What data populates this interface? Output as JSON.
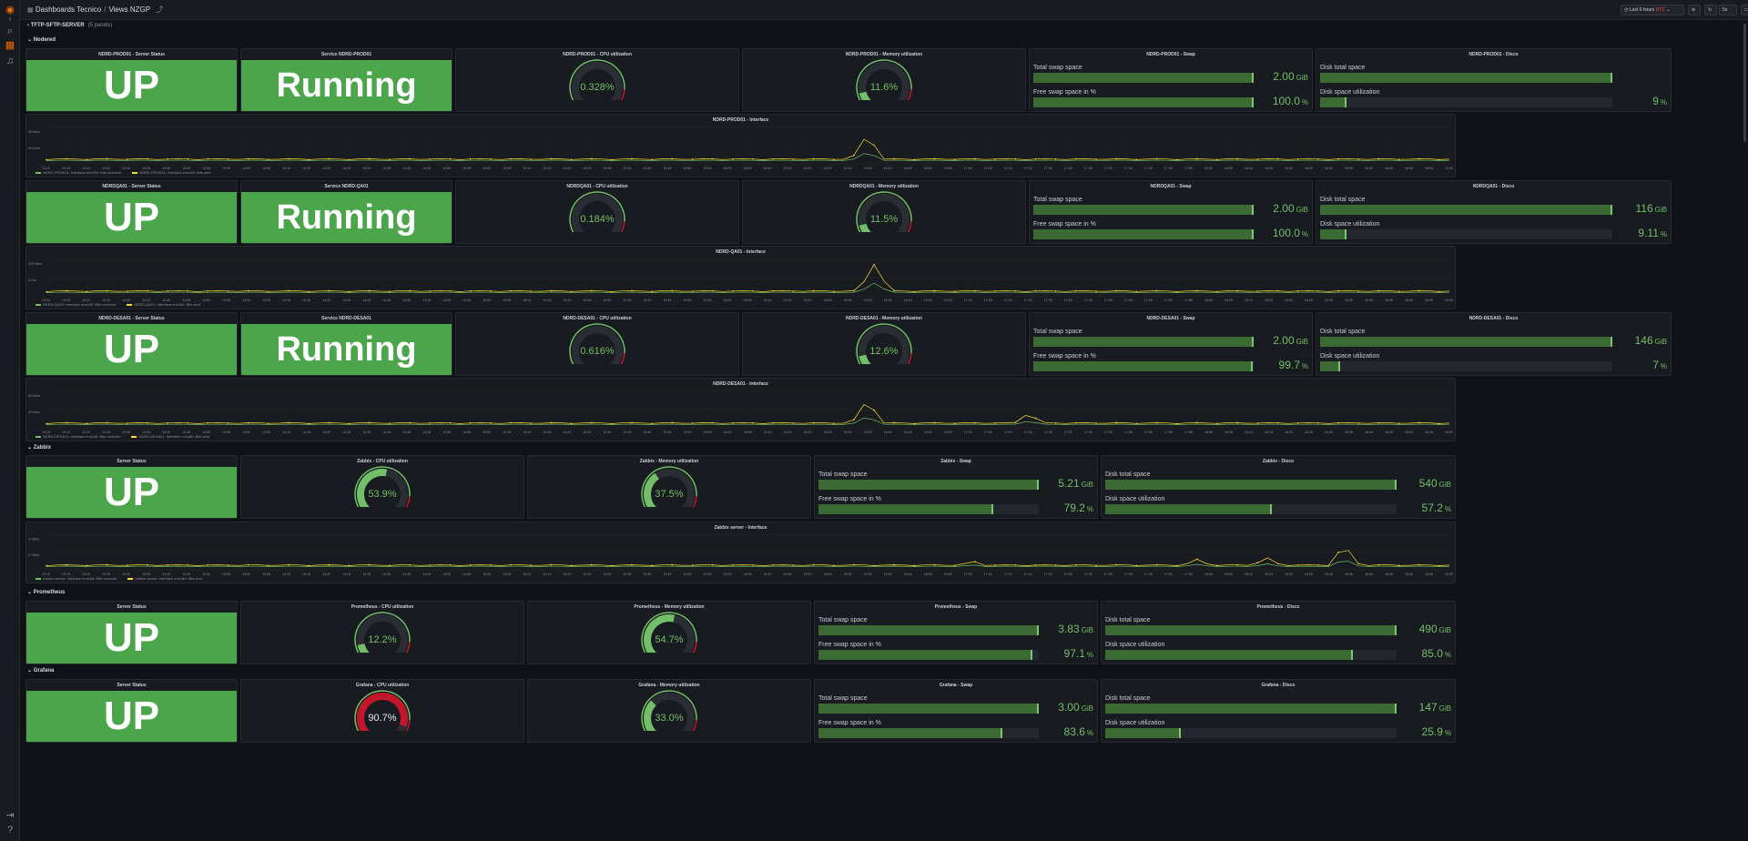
{
  "breadcrumb": {
    "folder": "Dashboards Tecnico",
    "dashboard": "Views NZGP"
  },
  "toolbar": {
    "time_range": "Last 6 hours",
    "zoom": "UTC",
    "refresh": "5s"
  },
  "dropdown": {
    "label": "TFTP-SFTP-SERVER",
    "count": "(5 panels)"
  },
  "rows": [
    {
      "title": "Nodered"
    },
    {
      "title": "Zabbix"
    },
    {
      "title": "Prometheus"
    },
    {
      "title": "Grafana"
    }
  ],
  "time_labels": [
    "13:10",
    "13:15",
    "13:20",
    "13:25",
    "13:30",
    "13:35",
    "13:40",
    "13:45",
    "13:50",
    "13:55",
    "14:00",
    "14:05",
    "14:10",
    "14:15",
    "14:20",
    "14:25",
    "14:30",
    "14:35",
    "14:40",
    "14:45",
    "14:50",
    "14:55",
    "15:00",
    "15:05",
    "15:10",
    "15:15",
    "15:20",
    "15:25",
    "15:30",
    "15:35",
    "15:40",
    "15:45",
    "15:50",
    "15:55",
    "16:00",
    "16:05",
    "16:10",
    "16:15",
    "16:20",
    "16:25",
    "16:30",
    "16:35",
    "16:40",
    "16:45",
    "16:50",
    "16:55",
    "17:00",
    "17:05",
    "17:10",
    "17:15",
    "17:20",
    "17:25",
    "17:30",
    "17:35",
    "17:40",
    "17:45",
    "17:50",
    "17:55",
    "18:00",
    "18:05",
    "18:10",
    "18:15",
    "18:20",
    "18:25",
    "18:30",
    "18:35",
    "18:40",
    "18:45",
    "18:50",
    "18:55",
    "19:00"
  ],
  "groups": [
    {
      "status": {
        "title": "NDRD-PROD01 - Server Status",
        "value": "UP"
      },
      "service": {
        "title": "Service NDRD-PROD01",
        "value": "Running"
      },
      "cpu": {
        "title": "NDRD-PROD01 - CPU utilization",
        "value": "0.328%",
        "pct": 0.33
      },
      "mem": {
        "title": "NDRD-PROD01 - Memory utilization",
        "value": "11.6%",
        "pct": 11.6
      },
      "swap": {
        "title": "NDRD-PROD01 - Swap",
        "l1": "Total swap space",
        "v1": "2.00",
        "u1": "GiB",
        "f1": 100,
        "l2": "Free swap space in %",
        "v2": "100.0",
        "u2": "%",
        "f2": 100
      },
      "disk": {
        "title": "NDRD-PROD01 - Disco",
        "l1": "Disk total space",
        "v1": "",
        "u1": "",
        "f1": 100,
        "l2": "Disk space utilization",
        "v2": "9",
        "u2": "%",
        "f2": 9
      },
      "iface": {
        "title": "NDRD-PROD01 - Interface",
        "y1": "40 kb/s",
        "y2": "20 kb/s",
        "l1": "NDRD-PROD01: Interface ens160: Bits received",
        "l2": "NDRD-PROD01: Interface ens160: Bits sent",
        "spikes": [
          {
            "at": 0.585,
            "h": 0.8
          }
        ]
      }
    },
    {
      "status": {
        "title": "NDRDQA01 - Server Status",
        "value": "UP"
      },
      "service": {
        "title": "Service NDRD-QA01",
        "value": "Running"
      },
      "cpu": {
        "title": "NDRDQA01 - CPU utilization",
        "value": "0.184%",
        "pct": 0.18
      },
      "mem": {
        "title": "NDRDQA01 - Memory utilization",
        "value": "11.5%",
        "pct": 11.5
      },
      "swap": {
        "title": "NDRDQA01 - Swap",
        "l1": "Total swap space",
        "v1": "2.00",
        "u1": "GiB",
        "f1": 100,
        "l2": "Free swap space in %",
        "v2": "100.0",
        "u2": "%",
        "f2": 100
      },
      "disk": {
        "title": "NDRDQA01 - Disco",
        "l1": "Disk total space",
        "v1": "116",
        "u1": "GiB",
        "f1": 100,
        "l2": "Disk space utilization",
        "v2": "9.11",
        "u2": "%",
        "f2": 9.1
      },
      "iface": {
        "title": "NDRD-QA01 - Interface",
        "y1": "100 kb/s",
        "y2": "0 b/s",
        "l1": "NDRD-QA01: Interface ens160: Bits received",
        "l2": "NDRD-QA01: Interface ens160: Bits sent",
        "spikes": [
          {
            "at": 0.59,
            "h": 0.85
          }
        ]
      }
    },
    {
      "status": {
        "title": "NDRD-DESA01 - Server Status",
        "value": "UP"
      },
      "service": {
        "title": "Service NDRD-DESA01",
        "value": "Running"
      },
      "cpu": {
        "title": "NDRD-DESA01 - CPU utilization",
        "value": "0.616%",
        "pct": 0.62
      },
      "mem": {
        "title": "NDRD-DESA01 - Memory utilization",
        "value": "12.6%",
        "pct": 12.6
      },
      "swap": {
        "title": "NDRD-DESA01 - Swap",
        "l1": "Total swap space",
        "v1": "2.00",
        "u1": "GiB",
        "f1": 100,
        "l2": "Free swap space in %",
        "v2": "99.7",
        "u2": "%",
        "f2": 99.7
      },
      "disk": {
        "title": "NDRD-DESA01 - Disco",
        "l1": "Disk total space",
        "v1": "146",
        "u1": "GiB",
        "f1": 100,
        "l2": "Disk space utilization",
        "v2": "7",
        "u2": "%",
        "f2": 7
      },
      "iface": {
        "title": "NDRD-DESA01 - Interface",
        "y1": "40 kb/s",
        "y2": "20 kb/s",
        "l1": "NDRD-DESA01: Interface ens160: Bits received",
        "l2": "NDRD-DESA01: Interface ens160: Bits sent",
        "spikes": [
          {
            "at": 0.585,
            "h": 0.75
          },
          {
            "at": 0.7,
            "h": 0.35
          }
        ]
      }
    }
  ],
  "services": [
    {
      "status": {
        "title": "Server Status",
        "value": "UP"
      },
      "cpu": {
        "title": "Zabbix - CPU utilization",
        "value": "53.9%",
        "pct": 53.9
      },
      "mem": {
        "title": "Zabbix - Memory utilization",
        "value": "37.5%",
        "pct": 37.5
      },
      "swap": {
        "title": "Zabbix - Swap",
        "l1": "Total swap space",
        "v1": "5.21",
        "u1": "GiB",
        "f1": 100,
        "l2": "Free swap space in %",
        "v2": "79.2",
        "u2": "%",
        "f2": 79.2
      },
      "disk": {
        "title": "Zabbix - Disco",
        "l1": "Disk total space",
        "v1": "540",
        "u1": "GiB",
        "f1": 100,
        "l2": "Disk space utilization",
        "v2": "57.2",
        "u2": "%",
        "f2": 57.2
      },
      "iface": {
        "title": "Zabbix server - Interface",
        "y1": "4 Mb/s",
        "y2": "2 Mb/s",
        "l1": "Zabbix server: Interface ens160: Bits received",
        "l2": "Zabbix server: Interface ens160: Bits sent",
        "spikes": [
          {
            "at": 0.66,
            "h": 0.2
          },
          {
            "at": 0.82,
            "h": 0.25
          },
          {
            "at": 0.87,
            "h": 0.3
          },
          {
            "at": 0.925,
            "h": 0.7
          }
        ]
      }
    },
    {
      "status": {
        "title": "Server Status",
        "value": "UP"
      },
      "cpu": {
        "title": "Prometheus - CPU utilization",
        "value": "12.2%",
        "pct": 12.2
      },
      "mem": {
        "title": "Prometheus - Memory utilization",
        "value": "54.7%",
        "pct": 54.7
      },
      "swap": {
        "title": "Prometheus - Swap",
        "l1": "Total swap space",
        "v1": "3.83",
        "u1": "GiB",
        "f1": 100,
        "l2": "Free swap space in %",
        "v2": "97.1",
        "u2": "%",
        "f2": 97.1
      },
      "disk": {
        "title": "Prometheus - Disco",
        "l1": "Disk total space",
        "v1": "490",
        "u1": "GiB",
        "f1": 100,
        "l2": "Disk space utilization",
        "v2": "85.0",
        "u2": "%",
        "f2": 85
      }
    },
    {
      "status": {
        "title": "Server Status",
        "value": "UP"
      },
      "cpu": {
        "title": "Grafana - CPU utilization",
        "value": "90.7%",
        "pct": 90.7
      },
      "mem": {
        "title": "Grafana - Memory utilization",
        "value": "33.0%",
        "pct": 33
      },
      "swap": {
        "title": "Grafana - Swap",
        "l1": "Total swap space",
        "v1": "3.00",
        "u1": "GiB",
        "f1": 100,
        "l2": "Free swap space in %",
        "v2": "83.6",
        "u2": "%",
        "f2": 83.6
      },
      "disk": {
        "title": "Grafana - Disco",
        "l1": "Disk total space",
        "v1": "147",
        "u1": "GiB",
        "f1": 100,
        "l2": "Disk space utilization",
        "v2": "25.9",
        "u2": "%",
        "f2": 25.9
      }
    }
  ],
  "colors": {
    "green": "#73bf69",
    "stat_bg": "#4ba54b",
    "red": "#c4162a",
    "series1": "#73bf69",
    "series2": "#fade2a"
  }
}
